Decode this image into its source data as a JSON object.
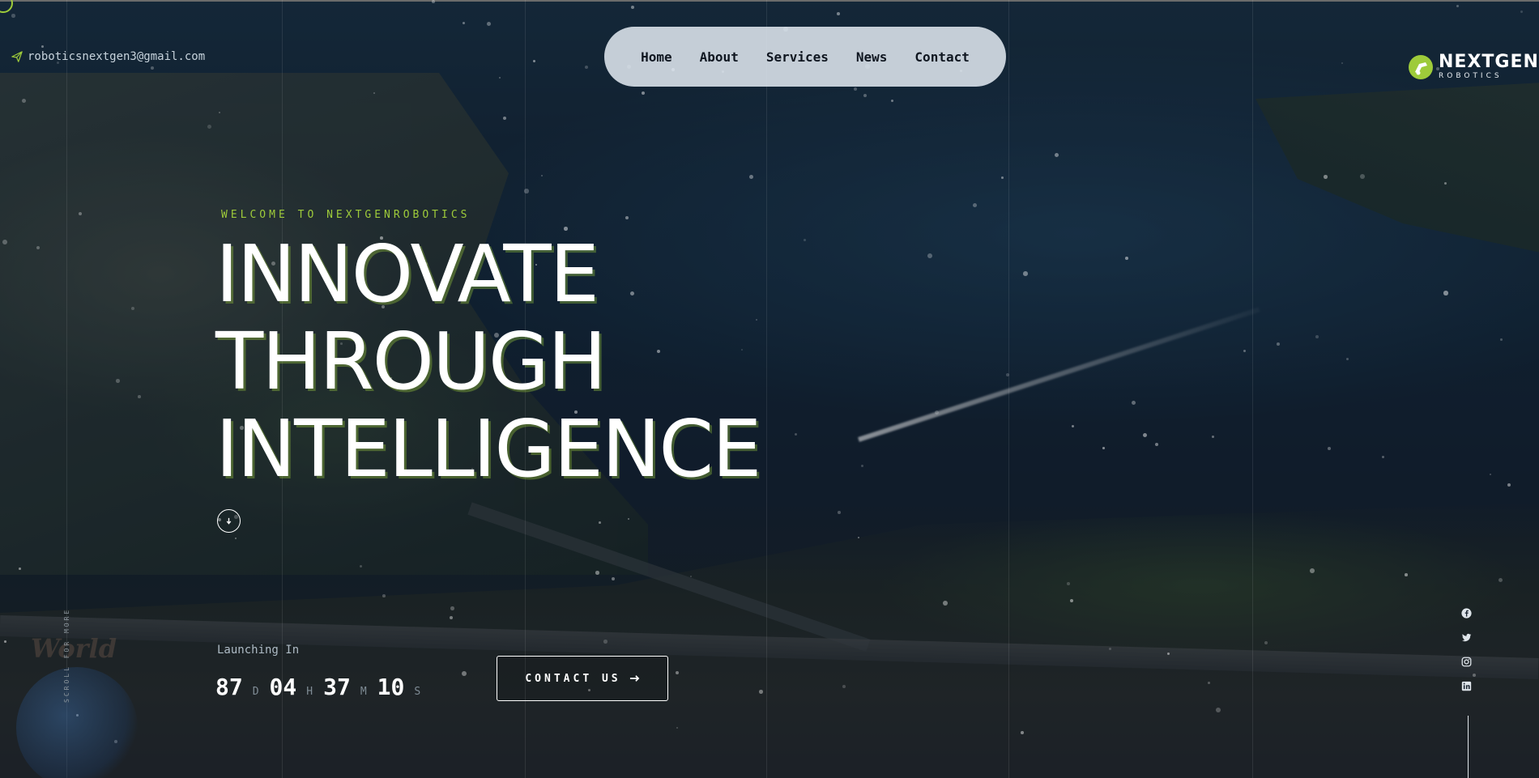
{
  "header": {
    "email": "roboticsnextgen3@gmail.com",
    "nav": [
      "Home",
      "About",
      "Services",
      "News",
      "Contact"
    ],
    "logo": {
      "main": "NEXTGEN",
      "sub": "ROBOTICS"
    }
  },
  "hero": {
    "welcome": "WELCOME TO NEXTGENROBOTICS",
    "headline": [
      "INNOVATE",
      "THROUGH",
      "INTELLIGENCE"
    ],
    "scroll_down_icon": "arrow-down-icon"
  },
  "countdown": {
    "label": "Launching In",
    "days": "87",
    "days_unit": "D",
    "hours": "04",
    "hours_unit": "H",
    "minutes": "37",
    "minutes_unit": "M",
    "seconds": "10",
    "seconds_unit": "S"
  },
  "cta": {
    "label": "CONTACT US",
    "icon": "arrow-right-icon"
  },
  "side": {
    "scroll_text": "SCROLL FOR MORE",
    "world_text": "World",
    "socials": [
      "facebook-icon",
      "twitter-icon",
      "instagram-icon",
      "linkedin-icon"
    ]
  },
  "colors": {
    "accent": "#9ecb3a",
    "nav_bg": "#dee6ee",
    "text": "#ffffff"
  }
}
